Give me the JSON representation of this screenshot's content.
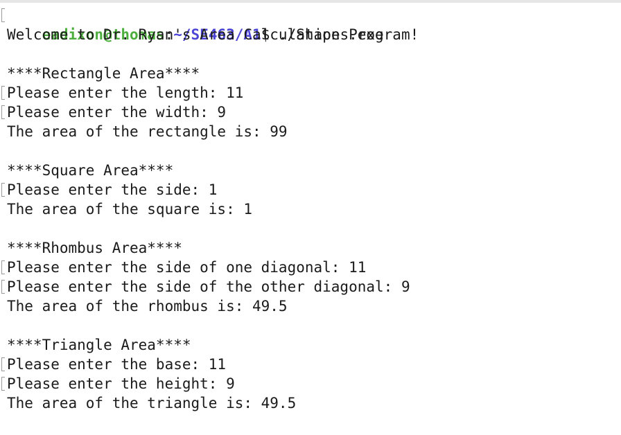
{
  "prompt": {
    "user_host": "eadixon@thomas",
    "separator": ":",
    "cwd": "~/SE463/A1",
    "symbol": "$",
    "command": " ./Shapes.exe"
  },
  "output": {
    "welcome": "Welcome to Dr. Ryan's Area Calculation Program!",
    "rectangle": {
      "header": "****Rectangle Area****",
      "prompt_length": "Please enter the length: 11",
      "prompt_width": "Please enter the width: 9",
      "result": "The area of the rectangle is: 99"
    },
    "square": {
      "header": "****Square Area****",
      "prompt_side": "Please enter the side: 1",
      "result": "The area of the square is: 1"
    },
    "rhombus": {
      "header": "****Rhombus Area****",
      "prompt_diag1": "Please enter the side of one diagonal: 11",
      "prompt_diag2": "Please enter the side of the other diagonal: 9",
      "result": "The area of the rhombus is: 49.5"
    },
    "triangle": {
      "header": "****Triangle Area****",
      "prompt_base": "Please enter the base: 11",
      "prompt_height": "Please enter the height: 9",
      "result": "The area of the triangle is: 49.5"
    }
  }
}
